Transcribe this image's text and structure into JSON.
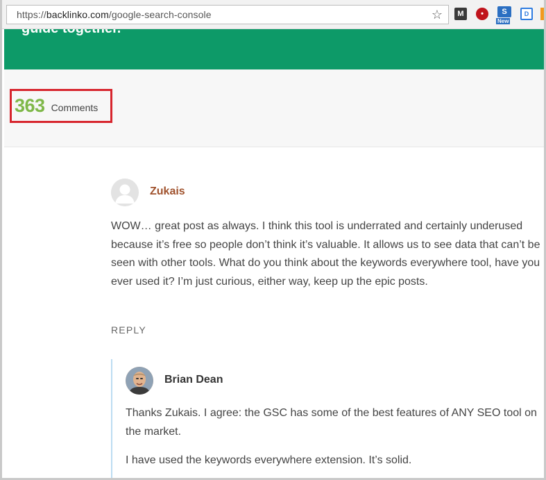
{
  "browser": {
    "url_prefix": "https://",
    "url_host": "backlinko.com",
    "url_path": "/google-search-console",
    "bookmark_icon": "star-icon",
    "extensions": [
      {
        "name": "m-extension-icon",
        "label": "M"
      },
      {
        "name": "red-extension-icon",
        "label": "•"
      },
      {
        "name": "s-extension-icon",
        "label": "S",
        "badge": "New"
      },
      {
        "name": "d-extension-icon",
        "label": "D"
      },
      {
        "name": "orange-extension-icon",
        "label": ""
      }
    ]
  },
  "banner": {
    "text": "guide together.",
    "color": "#0d9a68"
  },
  "comments_header": {
    "count": "363",
    "label": "Comments",
    "count_color": "#7fb849",
    "highlight_color": "#d7252d"
  },
  "comments": [
    {
      "author": "Zukais",
      "author_color": "#a0522d",
      "avatar": "default-avatar-icon",
      "text": "WOW… great post as always. I think this tool is underrated and certainly underused because it’s free so people don’t think it’s valuable. It allows us to see data that can’t be seen with other tools. What do you think about the keywords everywhere tool, have you ever used it? I’m just curious, either way, keep up the epic posts.",
      "reply_label": "REPLY",
      "replies": [
        {
          "author": "Brian Dean",
          "avatar": "author-photo",
          "paragraphs": [
            "Thanks Zukais. I agree: the GSC has some of the best features of ANY SEO tool on the market.",
            "I have used the keywords everywhere extension. It’s solid."
          ]
        }
      ]
    }
  ]
}
